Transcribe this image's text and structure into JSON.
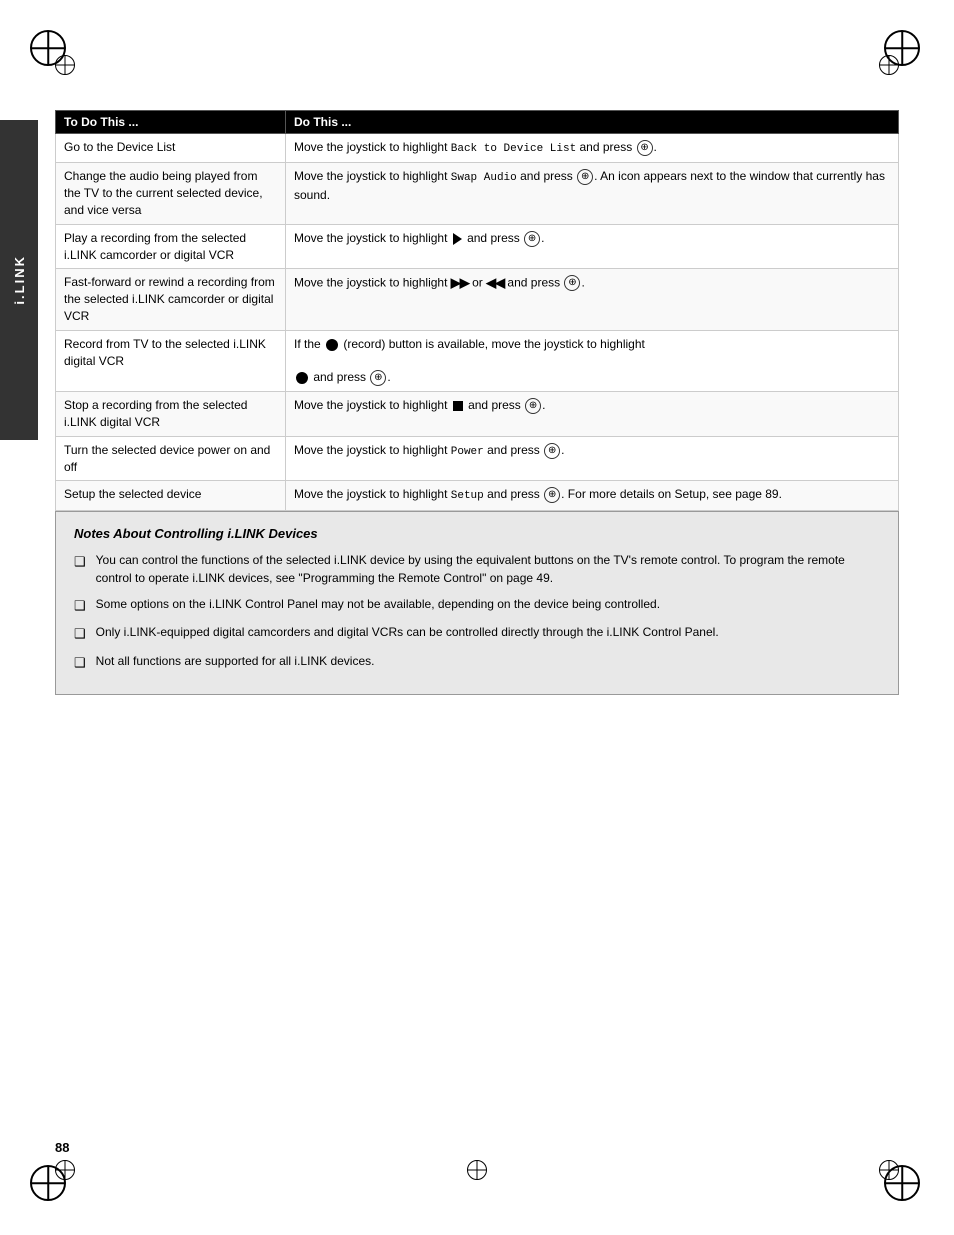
{
  "page": {
    "number": "88",
    "sidebar_label": "i.LINK"
  },
  "table": {
    "header": {
      "col1": "To Do This ...",
      "col2": "Do This ..."
    },
    "rows": [
      {
        "id": "row-device-list",
        "left": "Go to the Device List",
        "right_text": "Move the joystick to highlight Back to Device List and press",
        "right_suffix": ".",
        "has_enter": true,
        "inline_element": "none"
      },
      {
        "id": "row-swap-audio",
        "left": "Change the audio being played from the TV to the current selected device, and vice versa",
        "right_text": "Move the joystick to highlight Swap Audio and press",
        "right_suffix": ". An icon appears next to the window that currently has sound.",
        "has_enter": true,
        "inline_element": "none"
      },
      {
        "id": "row-play",
        "left": "Play a recording from the selected i.LINK camcorder or digital VCR",
        "right_text": "Move the joystick to highlight",
        "right_suffix": "and press",
        "right_end": ".",
        "has_enter": true,
        "inline_element": "play"
      },
      {
        "id": "row-ffrew",
        "left": "Fast-forward or rewind a recording from the selected i.LINK camcorder or digital VCR",
        "right_text": "Move the joystick to highlight",
        "right_suffix": "or",
        "right_end": "and press",
        "right_final": ".",
        "has_enter": true,
        "inline_element": "ffrew"
      },
      {
        "id": "row-record",
        "left": "Record from TV to the selected i.LINK digital VCR",
        "right_text": "If the",
        "right_middle": "(record) button is available, move the joystick to highlight",
        "right_end": "and press",
        "right_final": ".",
        "has_enter": true,
        "inline_element": "record"
      },
      {
        "id": "row-stop",
        "left": "Stop a recording from the selected i.LINK digital VCR",
        "right_text": "Move the joystick to highlight",
        "right_suffix": "and press",
        "right_end": ".",
        "has_enter": true,
        "inline_element": "stop"
      },
      {
        "id": "row-power",
        "left": "Turn the selected device power on and off",
        "right_text": "Move the joystick to highlight Power and press",
        "right_suffix": ".",
        "has_enter": true,
        "inline_element": "none"
      },
      {
        "id": "row-setup",
        "left": "Setup the selected device",
        "right_text": "Move the joystick to highlight Setup and press",
        "right_suffix": ". For more details on Setup, see page 89.",
        "has_enter": true,
        "inline_element": "none"
      }
    ]
  },
  "notes": {
    "title": "Notes About Controlling i.LINK Devices",
    "items": [
      "You can control the functions of the selected i.LINK device by using the equivalent buttons on the TV’s remote control. To program the remote control to operate i.LINK devices, see “Programming the Remote Control” on page 49.",
      "Some options on the i.LINK Control Panel may not be available, depending on the device being controlled.",
      "Only i.LINK-equipped digital camcorders and digital VCRs can be controlled directly through the i.LINK Control Panel.",
      "Not all functions are supported for all i.LINK devices."
    ]
  }
}
